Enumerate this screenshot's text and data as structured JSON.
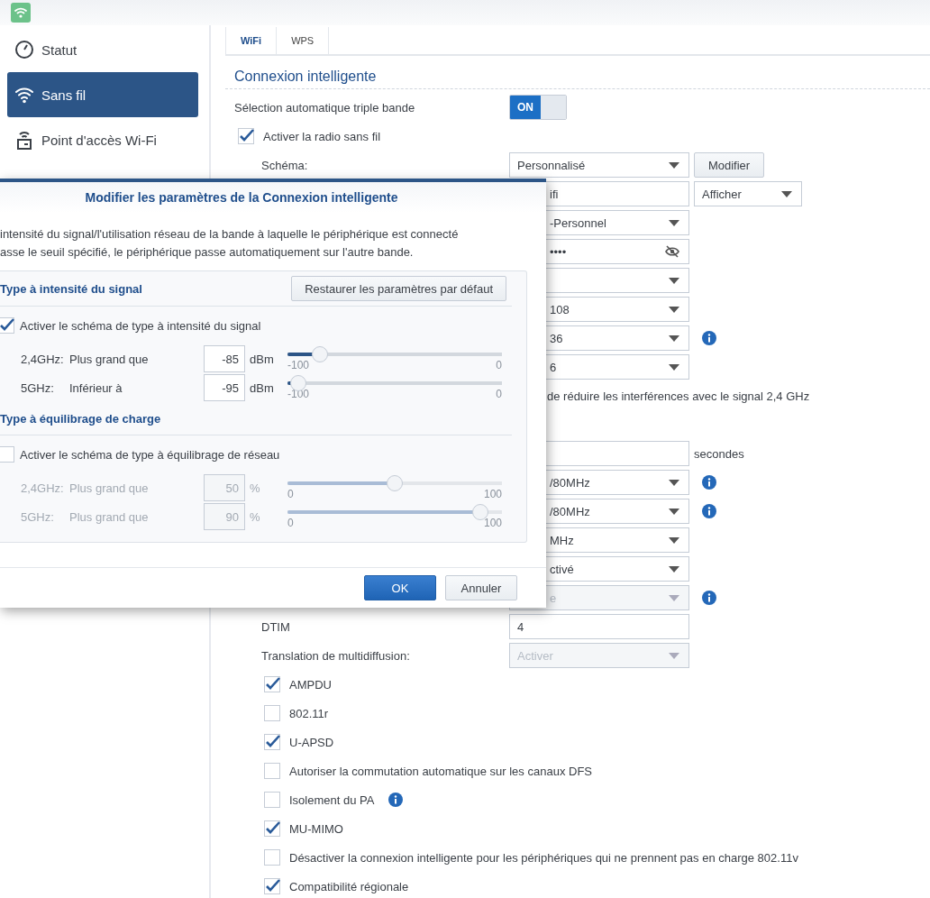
{
  "sidebar": {
    "items": [
      {
        "label": "Statut",
        "selected": false
      },
      {
        "label": "Sans fil",
        "selected": true
      },
      {
        "label": "Point d'accès Wi-Fi",
        "selected": false
      }
    ]
  },
  "tabs": [
    {
      "label": "WiFi",
      "selected": true
    },
    {
      "label": "WPS",
      "selected": false
    }
  ],
  "section_title": "Connexion intelligente",
  "triple_band": {
    "label": "Sélection automatique triple bande",
    "toggle": "ON",
    "on": true
  },
  "radio": {
    "label": "Activer la radio sans fil",
    "checked": true
  },
  "schema": {
    "label": "Schéma:",
    "value": "Personnalisé",
    "button": "Modifier"
  },
  "hidden_rows": [
    {
      "kind": "text",
      "value": "ifi",
      "extra": "Afficher"
    },
    {
      "kind": "select",
      "value": "-Personnel"
    },
    {
      "kind": "password",
      "value": "••••"
    },
    {
      "kind": "select"
    },
    {
      "kind": "select",
      "value": "108"
    },
    {
      "kind": "select",
      "value": "36",
      "info": true
    },
    {
      "kind": "select",
      "value": "6"
    },
    {
      "kind": "note",
      "value": "de réduire les interférences avec le signal 2,4 GHz"
    },
    {
      "kind": "blank"
    },
    {
      "kind": "text",
      "suffix": "secondes"
    },
    {
      "kind": "select",
      "value": "/80MHz",
      "info": true
    },
    {
      "kind": "select",
      "value": "/80MHz",
      "info": true
    },
    {
      "kind": "select",
      "value": "MHz"
    },
    {
      "kind": "select",
      "value": "ctivé"
    },
    {
      "kind": "disabled",
      "value": "e",
      "info": true
    }
  ],
  "dtim": {
    "label": "DTIM",
    "value": "4"
  },
  "multicast": {
    "label": "Translation de multidiffusion:",
    "value": "Activer"
  },
  "options": [
    {
      "label": "AMPDU",
      "checked": true
    },
    {
      "label": "802.11r",
      "checked": false
    },
    {
      "label": "U-APSD",
      "checked": true
    },
    {
      "label": "Autoriser la commutation automatique sur les canaux DFS",
      "checked": false
    },
    {
      "label": "Isolement du PA",
      "checked": false,
      "info": true
    },
    {
      "label": "MU-MIMO",
      "checked": true
    },
    {
      "label": "Désactiver la connexion intelligente pour les périphériques qui ne prennent pas en charge 802.11v",
      "checked": false
    },
    {
      "label": "Compatibilité régionale",
      "checked": true
    }
  ],
  "dialog": {
    "title": "Modifier les paramètres de la Connexion intelligente",
    "description": [
      "intensité du signal/l'utilisation réseau de la bande à laquelle le périphérique est connecté",
      "asse le seuil spécifié, le périphérique passe automatiquement sur l'autre bande."
    ],
    "restore_button": "Restaurer les paramètres par défaut",
    "sections": [
      {
        "title": "Type à intensité du signal",
        "checkbox": {
          "label": "Activer le schéma de type à intensité du signal",
          "checked": true
        },
        "rows": [
          {
            "band": "2,4GHz:",
            "condition": "Plus grand que",
            "value": "-85",
            "unit": "dBm",
            "level": 0.15,
            "min": "-100",
            "max": "0"
          },
          {
            "band": "5GHz:",
            "condition": "Inférieur à",
            "value": "-95",
            "unit": "dBm",
            "level": 0.05,
            "min": "-100",
            "max": "0"
          }
        ]
      },
      {
        "title": "Type à équilibrage de charge",
        "checkbox": {
          "label": "Activer le schéma de type à équilibrage de réseau",
          "checked": false
        },
        "rows": [
          {
            "band": "2,4GHz:",
            "condition": "Plus grand que",
            "value": "50",
            "unit": "%",
            "level": 0.5,
            "min": "0",
            "max": "100"
          },
          {
            "band": "5GHz:",
            "condition": "Plus grand que",
            "value": "90",
            "unit": "%",
            "level": 0.9,
            "min": "0",
            "max": "100"
          }
        ]
      }
    ],
    "ok": "OK",
    "cancel": "Annuler"
  }
}
